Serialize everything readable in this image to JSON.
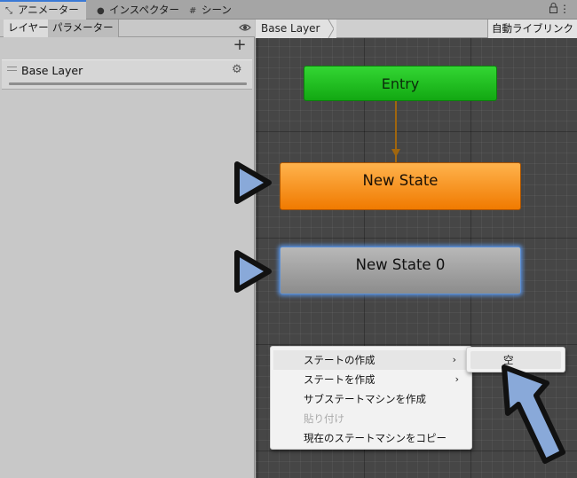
{
  "tabs": [
    {
      "label": "アニメーター",
      "icon": "animator-icon",
      "active": true
    },
    {
      "label": "インスペクター",
      "icon": "info-icon",
      "active": false
    },
    {
      "label": "シーン",
      "icon": "hash-icon",
      "active": false
    }
  ],
  "left_panel": {
    "subtabs": [
      "レイヤー",
      "パラメーター"
    ],
    "add_label": "+",
    "layer_name": "Base Layer"
  },
  "graph": {
    "breadcrumb": "Base Layer",
    "auto_live_link": "自動ライブリンク",
    "nodes": {
      "entry": "Entry",
      "new_state": "New State",
      "new_state0": "New State 0"
    }
  },
  "context_menu": {
    "items": [
      {
        "label": "ステートの作成",
        "submenu": true,
        "disabled": false
      },
      {
        "label": "ステートを作成",
        "submenu": true,
        "disabled": false
      },
      {
        "label": "サブステートマシンを作成",
        "submenu": false,
        "disabled": false
      },
      {
        "label": "貼り付け",
        "submenu": false,
        "disabled": true
      },
      {
        "label": "現在のステートマシンをコピー",
        "submenu": false,
        "disabled": false
      }
    ],
    "submenu_item": "空",
    "chevron": "›"
  },
  "colors": {
    "entry": "#1fbf1f",
    "new_state": "#f58a14",
    "selected_outline": "#5a96eb",
    "annotation_arrow": "#89a9d9"
  }
}
